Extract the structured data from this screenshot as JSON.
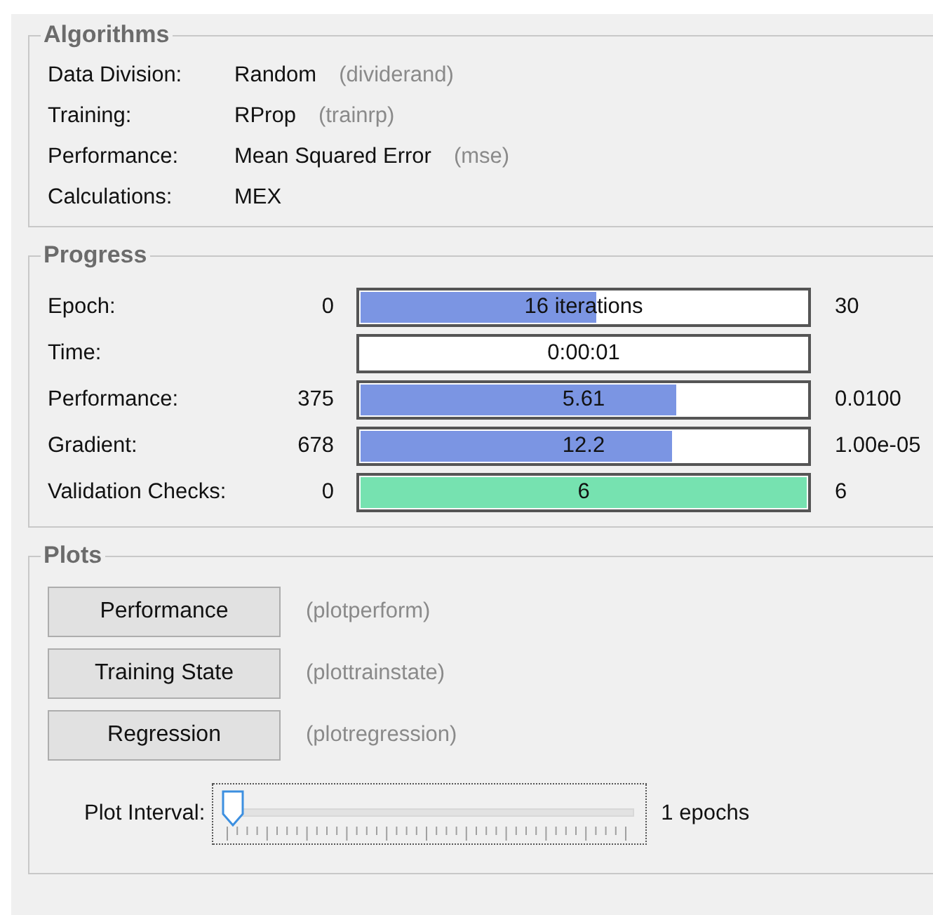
{
  "algorithms": {
    "title": "Algorithms",
    "rows": [
      {
        "label": "Data Division:",
        "value": "Random",
        "function": "(dividerand)"
      },
      {
        "label": "Training:",
        "value": "RProp",
        "function": "(trainrp)"
      },
      {
        "label": "Performance:",
        "value": "Mean Squared Error",
        "function": "(mse)"
      },
      {
        "label": "Calculations:",
        "value": "MEX"
      }
    ]
  },
  "progress": {
    "title": "Progress",
    "rows": [
      {
        "label": "Epoch:",
        "start": "0",
        "bar_text": "16 iterations",
        "level": 0.53,
        "color": "#7b95e3",
        "end": "30"
      },
      {
        "label": "Time:",
        "bar_text": "0:00:01"
      },
      {
        "label": "Performance:",
        "start": "375",
        "bar_text": "5.61",
        "level": 0.71,
        "color": "#7b95e3",
        "end": "0.0100"
      },
      {
        "label": "Gradient:",
        "start": "678",
        "bar_text": "12.2",
        "level": 0.7,
        "color": "#7b95e3",
        "end": "1.00e-05"
      },
      {
        "label": "Validation Checks:",
        "start": "0",
        "bar_text": "6",
        "level": 1,
        "color": "#76e2b0",
        "end": "6"
      }
    ]
  },
  "plots": {
    "title": "Plots",
    "buttons": [
      {
        "label": "Performance",
        "function": "(plotperform)"
      },
      {
        "label": "Training State",
        "function": "(plottrainstate)"
      },
      {
        "label": "Regression",
        "function": "(plotregression)"
      }
    ],
    "plot_interval": {
      "label": "Plot Interval:",
      "level": 0,
      "reading": "1 epochs"
    }
  }
}
